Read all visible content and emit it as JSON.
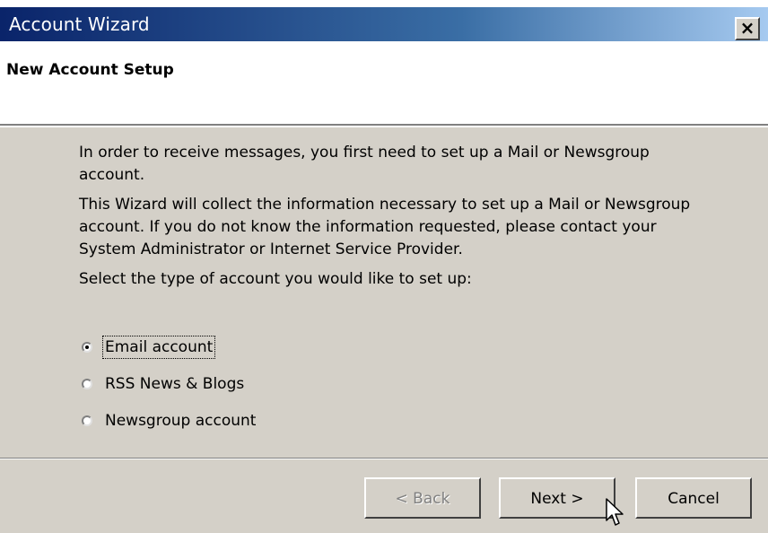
{
  "window": {
    "title": "Account Wizard",
    "close_label": "×"
  },
  "header": {
    "title": "New Account Setup"
  },
  "content": {
    "paragraph1": "In order to receive messages, you first need to set up a Mail or Newsgroup account.",
    "paragraph2": "This Wizard will collect the information necessary to set up a Mail or Newsgroup account. If you do not know the information requested, please contact your System Administrator or Internet Service Provider.",
    "prompt": "Select the type of account you would like to set up:"
  },
  "account_types": {
    "selected": "Email account",
    "options": [
      {
        "label": "Email account",
        "checked": true
      },
      {
        "label": "RSS News & Blogs",
        "checked": false
      },
      {
        "label": "Newsgroup account",
        "checked": false
      }
    ]
  },
  "buttons": {
    "back_label": "< Back",
    "next_label": "Next >",
    "cancel_label": "Cancel"
  },
  "colors": {
    "titlebar_start": "#0a246a",
    "titlebar_end": "#a6caf0",
    "dialog_bg": "#d4d0c8",
    "header_bg": "#ffffff",
    "disabled_text": "#808080"
  }
}
